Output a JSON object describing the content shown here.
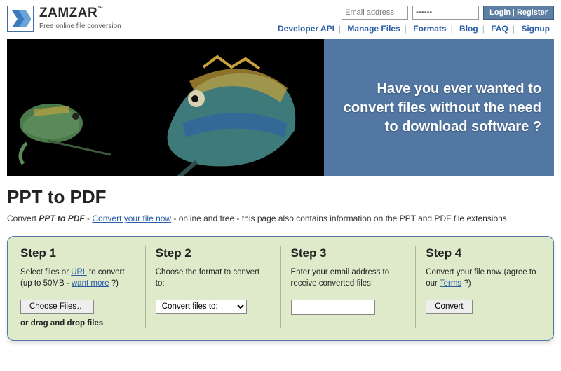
{
  "brand": {
    "name": "ZAMZAR",
    "tm": "™",
    "tagline": "Free online file conversion"
  },
  "inputs": {
    "email_placeholder": "Email address",
    "password_placeholder": "••••••"
  },
  "auth": {
    "login": "Login",
    "register": "Register"
  },
  "nav": {
    "developer_api": "Developer API",
    "manage_files": "Manage Files",
    "formats": "Formats",
    "blog": "Blog",
    "faq": "FAQ",
    "signup": "Signup"
  },
  "hero": {
    "headline": "Have you ever wanted to convert files without the need to download software ?"
  },
  "title": "PPT to PDF",
  "subtitle": {
    "pre": "Convert ",
    "em": "PPT to PDF",
    "dash1": " - ",
    "link": "Convert your file now",
    "rest": " - online and free - this page also contains information on the PPT and PDF file extensions."
  },
  "steps": {
    "s1": {
      "title": "Step 1",
      "desc_pre": "Select files or ",
      "url_link": "URL",
      "desc_mid": " to convert (up to 50MB - ",
      "want_more": "want more",
      "desc_end": " ?)",
      "choose": "Choose Files…",
      "drag": "or drag and drop files"
    },
    "s2": {
      "title": "Step 2",
      "desc": "Choose the format to convert to:",
      "select_label": "Convert files to:"
    },
    "s3": {
      "title": "Step 3",
      "desc": "Enter your email address to receive converted files:"
    },
    "s4": {
      "title": "Step 4",
      "desc_pre": "Convert your file now (agree to our ",
      "terms": "Terms",
      "desc_end": " ?)",
      "btn": "Convert"
    }
  }
}
